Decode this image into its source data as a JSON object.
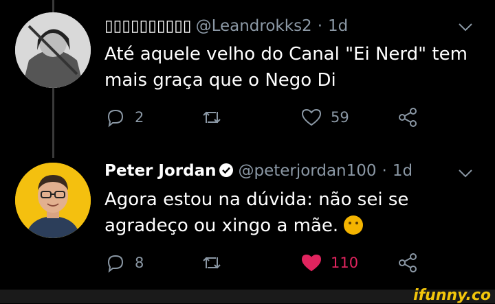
{
  "tweets": [
    {
      "display_name": "▯▯▯▯▯▯▯▯▯▯",
      "handle": "@Leandrokks2",
      "time": "1d",
      "text": "Até aquele velho do Canal \"Ei Nerd\" tem mais graça que o Nego Di",
      "replies": "2",
      "retweets": "",
      "likes": "59",
      "liked": false
    },
    {
      "display_name": "Peter Jordan",
      "handle": "@peterjordan100",
      "time": "1d",
      "verified": true,
      "text": "Agora estou na dúvida: não sei se agradeço ou xingo a mãe.",
      "emoji": "thinking-face",
      "replies": "8",
      "retweets": "",
      "likes": "110",
      "liked": true
    }
  ],
  "separator": "·",
  "footer": {
    "brand": "ifunny.co"
  },
  "colors": {
    "muted": "#8b98a5",
    "like": "#e0245e",
    "verified": "#ffffff",
    "brand": "#f3c60b"
  }
}
